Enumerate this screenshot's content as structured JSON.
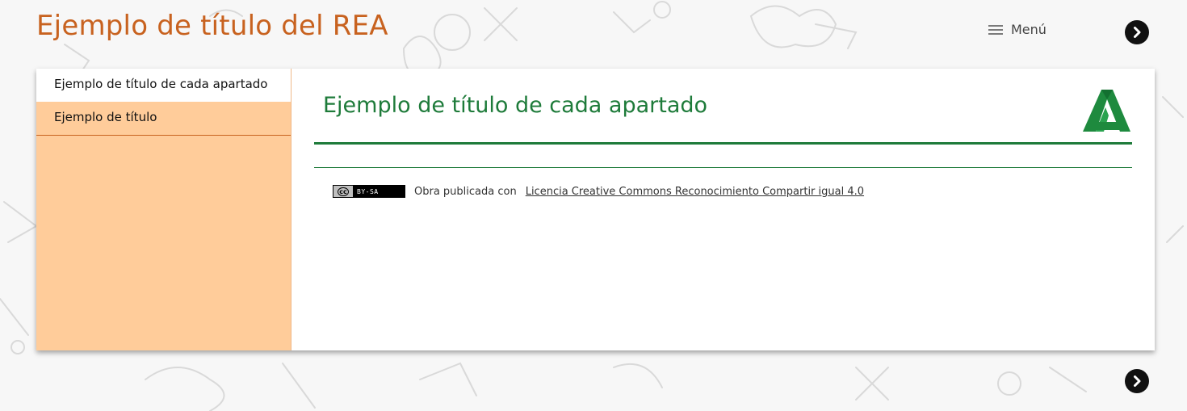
{
  "header": {
    "site_title": "Ejemplo de título del REA",
    "menu_label": "Menú",
    "menu_icon": "hamburger-icon",
    "next_icon": "chevron-right-icon"
  },
  "sidebar": {
    "items": [
      {
        "label": "Ejemplo de título de cada apartado",
        "active": true
      },
      {
        "label": "Ejemplo de título",
        "active": false
      }
    ]
  },
  "main": {
    "title": "Ejemplo de título de cada apartado",
    "logo_icon": "junta-andalucia-logo"
  },
  "license": {
    "badge_cc": "cc",
    "badge_terms": "BY-SA",
    "text": "Obra publicada con",
    "link_text": "Licencia Creative Commons Reconocimiento Compartir igual 4.0"
  },
  "colors": {
    "title_orange": "#c8621f",
    "sidebar_bg": "#ffcc9a",
    "accent_green": "#1e7b3a",
    "nav_button": "#111111"
  }
}
